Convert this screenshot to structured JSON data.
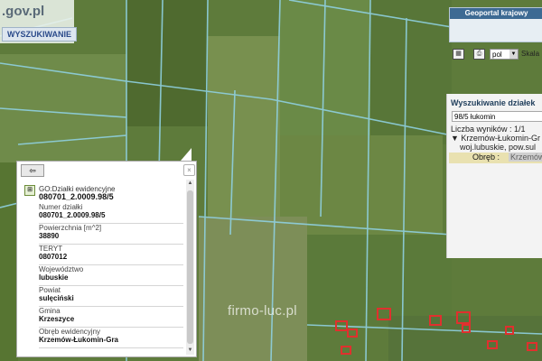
{
  "header": {
    "logo_text": ".gov.pl",
    "search_button": "WYSZUKIWANIE"
  },
  "overview_map": {
    "title": "Geoportal krajowy"
  },
  "toolbar": {
    "icon_names": [
      "grid-icon",
      "printer-icon"
    ],
    "language": "pol",
    "scale_label": "Skala"
  },
  "results_panel": {
    "title": "Wyszukiwanie działek",
    "query": "98/5 łukomin",
    "count": "Liczba wyników : 1/1",
    "tree_item": "Krzemów-Łukomin-Gr",
    "region": "woj.lubuskie, pow.sul",
    "row_label": "Obręb :",
    "row_value": "Krzemów"
  },
  "popup": {
    "back_label": "⇦",
    "close_label": "×",
    "layer_name": "GO:Działki ewidencyjne",
    "layer_id": "080701_2.0009.98/5",
    "fields": [
      {
        "label": "Numer działki",
        "value": "080701_2.0009.98/5"
      },
      {
        "label": "Powierzchnia [m^2]",
        "value": "38890"
      },
      {
        "label": "TERYT",
        "value": "0807012"
      },
      {
        "label": "Województwo",
        "value": "lubuskie"
      },
      {
        "label": "Powiat",
        "value": "sulęciński"
      },
      {
        "label": "Gmina",
        "value": "Krzeszyce"
      },
      {
        "label": "Obręb ewidencyjny",
        "value": "Krzemów-Łukomin-Gra"
      }
    ]
  },
  "watermark": "firmo-luc.pl",
  "colors": {
    "parcel_line": "#8fd0e0",
    "building": "#e0302e",
    "imagery": "#5f7a3a"
  }
}
